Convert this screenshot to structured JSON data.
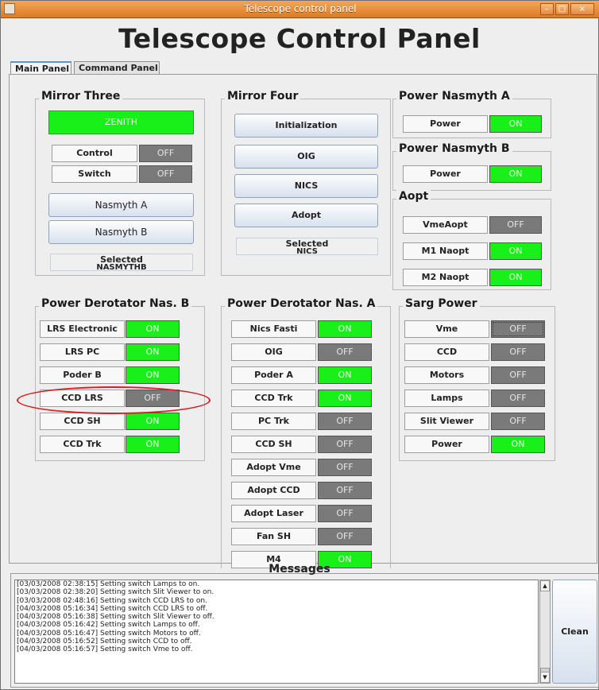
{
  "window": {
    "title": "Telescope control panel"
  },
  "app": {
    "heading": "Telescope Control Panel"
  },
  "tabs": [
    "Main Panel",
    "Command Panel"
  ],
  "mirror_three": {
    "title": "Mirror Three",
    "zenith": "ZENITH",
    "rows": [
      {
        "label": "Control",
        "state": "OFF"
      },
      {
        "label": "Switch",
        "state": "OFF"
      }
    ],
    "nasmyth_a": "Nasmyth A",
    "nasmyth_b": "Nasmyth B",
    "selected_label": "Selected",
    "selected_value": "NASMYTHB"
  },
  "mirror_four": {
    "title": "Mirror Four",
    "buttons": [
      "Initialization",
      "OIG",
      "NICS",
      "Adopt"
    ],
    "selected_label": "Selected",
    "selected_value": "NICS"
  },
  "power_nasmyth_a": {
    "title": "Power Nasmyth A",
    "rows": [
      {
        "label": "Power",
        "state": "ON"
      }
    ]
  },
  "power_nasmyth_b": {
    "title": "Power Nasmyth B",
    "rows": [
      {
        "label": "Power",
        "state": "ON"
      }
    ]
  },
  "aopt": {
    "title": "Aopt",
    "rows": [
      {
        "label": "VmeAopt",
        "state": "OFF"
      },
      {
        "label": "M1 Naopt",
        "state": "ON"
      },
      {
        "label": "M2 Naopt",
        "state": "ON"
      }
    ]
  },
  "derotator_b": {
    "title": "Power Derotator Nas. B",
    "rows": [
      {
        "label": "LRS Electronic",
        "state": "ON"
      },
      {
        "label": "LRS PC",
        "state": "ON"
      },
      {
        "label": "Poder B",
        "state": "ON"
      },
      {
        "label": "CCD LRS",
        "state": "OFF"
      },
      {
        "label": "CCD SH",
        "state": "ON"
      },
      {
        "label": "CCD Trk",
        "state": "ON"
      }
    ]
  },
  "derotator_a": {
    "title": "Power Derotator Nas. A",
    "rows": [
      {
        "label": "Nics Fasti",
        "state": "ON"
      },
      {
        "label": "OIG",
        "state": "OFF"
      },
      {
        "label": "Poder A",
        "state": "ON"
      },
      {
        "label": "CCD Trk",
        "state": "ON"
      },
      {
        "label": "PC Trk",
        "state": "OFF"
      },
      {
        "label": "CCD SH",
        "state": "OFF"
      },
      {
        "label": "Adopt Vme",
        "state": "OFF"
      },
      {
        "label": "Adopt CCD",
        "state": "OFF"
      },
      {
        "label": "Adopt Laser",
        "state": "OFF"
      },
      {
        "label": "Fan SH",
        "state": "OFF"
      },
      {
        "label": "M4",
        "state": "ON"
      }
    ]
  },
  "sarg_power": {
    "title": "Sarg Power",
    "rows": [
      {
        "label": "Vme",
        "state": "OFF"
      },
      {
        "label": "CCD",
        "state": "OFF"
      },
      {
        "label": "Motors",
        "state": "OFF"
      },
      {
        "label": "Lamps",
        "state": "OFF"
      },
      {
        "label": "Slit Viewer",
        "state": "OFF"
      },
      {
        "label": "Power",
        "state": "ON"
      }
    ]
  },
  "messages": {
    "title": "Messages",
    "lines": [
      "[03/03/2008 02:38:15]  Setting switch Lamps to on.",
      "[03/03/2008 02:38:20]  Setting switch Slit Viewer to on.",
      "[03/03/2008 02:48:16]  Setting switch CCD LRS to on.",
      "[04/03/2008 05:16:34]  Setting switch CCD LRS to off.",
      "[04/03/2008 05:16:38]  Setting switch Slit Viewer to off.",
      "[04/03/2008 05:16:42]  Setting switch Lamps to off.",
      "[04/03/2008 05:16:47]  Setting switch Motors to off.",
      "[04/03/2008 05:16:52]  Setting switch CCD to off.",
      "[04/03/2008 05:16:57]  Setting switch Vme to off."
    ],
    "clean_label": "Clean"
  },
  "colors": {
    "on": "#19f019",
    "off": "#7a7a7a",
    "titlebar": "#e8892f",
    "highlight_ring": "#d42020"
  }
}
